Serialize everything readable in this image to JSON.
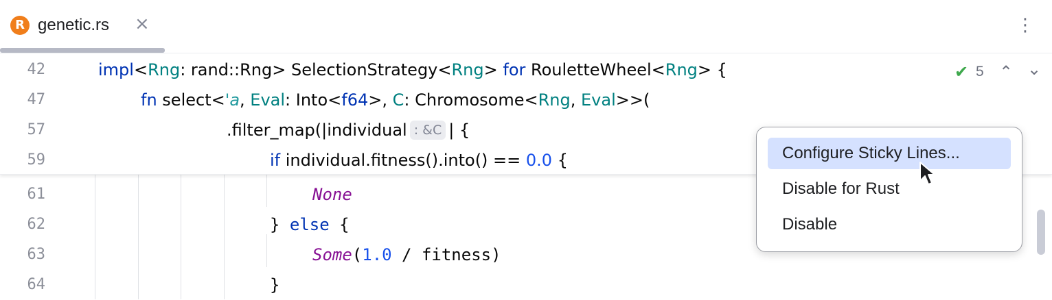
{
  "tab": {
    "title": "genetic.rs",
    "icon_letter": "R",
    "close_glyph": "×"
  },
  "tab_menu_glyph": "⋮",
  "inspections": {
    "count": "5",
    "check_glyph": "✔"
  },
  "nav": {
    "up_glyph": "⌃",
    "down_glyph": "⌄"
  },
  "lines": [
    {
      "number": "42"
    },
    {
      "number": "47"
    },
    {
      "number": "57"
    },
    {
      "number": "59"
    },
    {
      "number": "61"
    },
    {
      "number": "62"
    },
    {
      "number": "63"
    },
    {
      "number": "64"
    }
  ],
  "code": {
    "l42": {
      "impl": "impl",
      "lt1": "<",
      "rng1": "Rng",
      "colon1": ": rand::Rng> SelectionStrategy<",
      "rng2": "Rng",
      "gt1": "> ",
      "for": "for",
      "rw": " RouletteWheel<",
      "rng3": "Rng",
      "end": "> {"
    },
    "l47": {
      "fn": "fn",
      "sel": " select<",
      "a": "'a",
      "c1": ", ",
      "eval1": "Eval",
      "into": ": Into<",
      "f64": "f64",
      "c2": ">, ",
      "cc": "C",
      "chrom": ": Chromosome<",
      "rng": "Rng",
      "c3": ", ",
      "eval2": "Eval",
      "end": ">>("
    },
    "l57": {
      "pre": ".filter_map(|individual",
      "hint": ": &C",
      "post": "| {"
    },
    "l59": {
      "if": "if",
      "mid": " individual.fitness().into() == ",
      "num": "0.0",
      "end": " {"
    },
    "l61": {
      "none": "None"
    },
    "l62": {
      "b1": "} ",
      "else": "else",
      "b2": " {"
    },
    "l63": {
      "some": "Some",
      "p1": "(",
      "num": "1.0",
      "rest": " / fitness)"
    },
    "l64": {
      "brace": "}"
    }
  },
  "popup_menu": {
    "items": [
      {
        "label": "Configure Sticky Lines...",
        "selected": true
      },
      {
        "label": "Disable for Rust",
        "selected": false
      },
      {
        "label": "Disable",
        "selected": false
      }
    ]
  },
  "colors": {
    "keyword": "#0033b3",
    "type": "#008080",
    "number": "#1750eb",
    "enum_variant": "#871094",
    "rust_icon": "#f07e1b",
    "menu_selection": "#d5e1ff"
  }
}
